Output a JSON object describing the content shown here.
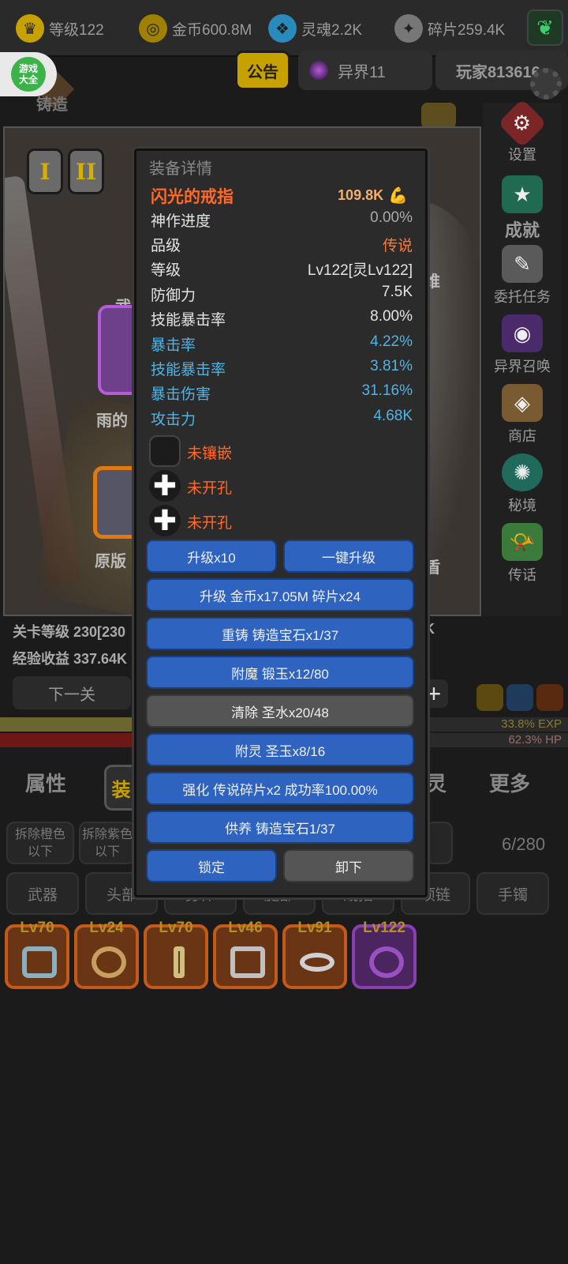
{
  "topbar": {
    "resources": [
      {
        "label": "等级122",
        "icon": "crown-icon",
        "color": "#c7a100"
      },
      {
        "label": "金币600.8M",
        "icon": "coin-icon",
        "color": "#c7a100"
      },
      {
        "label": "灵魂2.2K",
        "icon": "soul-icon",
        "color": "#3aa0d0"
      },
      {
        "label": "碎片259.4K",
        "icon": "shard-icon",
        "color": "#888888"
      }
    ]
  },
  "header": {
    "game_badge": "游戏\n大全",
    "notice": "公告",
    "realm": "异界11",
    "player": "玩家813616",
    "forge": "铸造"
  },
  "sidebar": {
    "items": [
      {
        "label": "设置",
        "icon": "diamond-gear-icon",
        "color": "#8a2a2a"
      },
      {
        "label": "成就",
        "icon": "star-icon",
        "color": "#1f7a5a"
      },
      {
        "label": "委托任务",
        "icon": "quest-icon",
        "color": "#6a6a6a"
      },
      {
        "label": "异界召唤",
        "icon": "portal-icon",
        "color": "#4a2a6a"
      },
      {
        "label": "商店",
        "icon": "shop-bag-icon",
        "color": "#7a5a30"
      },
      {
        "label": "秘境",
        "icon": "secret-realm-icon",
        "color": "#1f6a5a"
      },
      {
        "label": "传话",
        "icon": "horn-icon",
        "color": "#3a7a3a"
      }
    ]
  },
  "equip_panel": {
    "tier_buttons": [
      "I",
      "II"
    ],
    "weapon_label": "武",
    "weapon_name": "雨的",
    "orig_label": "原版",
    "right_char_1": "维",
    "right_char_2": "盾"
  },
  "stage": {
    "level_line": "关卡等级 230[230",
    "exp_line": "经验收益 337.64K",
    "right_k": "K",
    "next_button": "下一关",
    "exp_percent": "33.8% EXP",
    "exp_fill": 0.338,
    "hp_percent": "62.3%  HP",
    "hp_fill": 0.623
  },
  "bottom_tabs": {
    "attr": "属性",
    "equip_active": "装",
    "spirit": "灵",
    "more": "更多"
  },
  "filters": {
    "remove_orange": "拆除橙色\n以下",
    "remove_purple": "拆除紫色\n以下",
    "count": "6/280",
    "categories": [
      "武器",
      "头部",
      "身体",
      "腿部",
      "戒指",
      "项链",
      "手镯"
    ]
  },
  "inventory": [
    {
      "level": "Lv70",
      "rarity": "orange"
    },
    {
      "level": "Lv24",
      "rarity": "orange"
    },
    {
      "level": "Lv70",
      "rarity": "orange"
    },
    {
      "level": "Lv46",
      "rarity": "orange"
    },
    {
      "level": "Lv91",
      "rarity": "orange"
    },
    {
      "level": "Lv122",
      "rarity": "purple"
    }
  ],
  "modal": {
    "title": "装备详情",
    "item_name": "闪光的戒指",
    "power": "109.8K",
    "stats": [
      {
        "key": "神作进度",
        "value": "0.00%",
        "style": "white"
      },
      {
        "key": "品级",
        "value": "传说",
        "style": "white-orange"
      },
      {
        "key": "等级",
        "value": "Lv122[灵Lv122]",
        "style": "white"
      },
      {
        "key": "防御力",
        "value": "7.5K",
        "style": "white"
      },
      {
        "key": "技能暴击率",
        "value": "8.00%",
        "style": "white"
      },
      {
        "key": "暴击率",
        "value": "4.22%",
        "style": "blue"
      },
      {
        "key": "技能暴击率",
        "value": "3.81%",
        "style": "blue"
      },
      {
        "key": "暴击伤害",
        "value": "31.16%",
        "style": "blue"
      },
      {
        "key": "攻击力",
        "value": "4.68K",
        "style": "blue"
      }
    ],
    "sockets": [
      {
        "label": "未镶嵌",
        "symbol": ""
      },
      {
        "label": "未开孔",
        "symbol": "✚"
      },
      {
        "label": "未开孔",
        "symbol": "✚"
      }
    ],
    "buttons": {
      "upgrade10": "升级x10",
      "upgrade_all": "一键升级",
      "upgrade_cost": "升级 金币x17.05M 碎片x24",
      "reforge": "重铸 铸造宝石x1/37",
      "enchant": "附魔 锻玉x12/80",
      "clear": "清除 圣水x20/48",
      "spirit": "附灵 圣玉x8/16",
      "strengthen": "强化 传说碎片x2 成功率100.00%",
      "nurture": "供养 铸造宝石1/37",
      "lock": "锁定",
      "unequip": "卸下"
    }
  }
}
